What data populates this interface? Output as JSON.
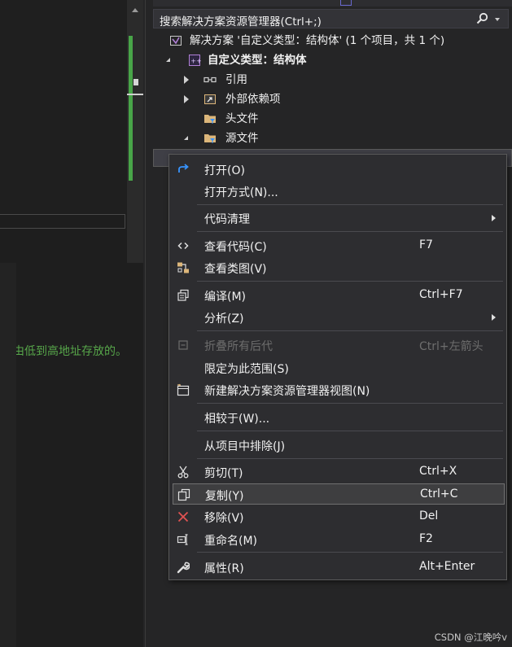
{
  "editor": {
    "comment_text": "由低到高地址存放的。"
  },
  "explorer": {
    "search_placeholder": "搜索解决方案资源管理器(Ctrl+;)",
    "tree": {
      "solution": "解决方案 '自定义类型：结构体' (1 个项目，共 1 个)",
      "project": "自定义类型：结构体",
      "references": "引用",
      "external_deps": "外部依赖项",
      "header_files": "头文件",
      "source_files": "源文件"
    }
  },
  "context_menu": {
    "items": [
      {
        "label": "打开(O)",
        "shortcut": "",
        "icon": "open-redo-icon",
        "enabled": true
      },
      {
        "label": "打开方式(N)...",
        "shortcut": "",
        "icon": "",
        "enabled": true
      },
      {
        "label": "代码清理",
        "shortcut": "",
        "icon": "",
        "enabled": true,
        "submenu": true
      },
      {
        "label": "查看代码(C)",
        "shortcut": "F7",
        "icon": "view-code-icon",
        "enabled": true
      },
      {
        "label": "查看类图(V)",
        "shortcut": "",
        "icon": "class-diagram-icon",
        "enabled": true
      },
      {
        "label": "编译(M)",
        "shortcut": "Ctrl+F7",
        "icon": "compile-icon",
        "enabled": true
      },
      {
        "label": "分析(Z)",
        "shortcut": "",
        "icon": "",
        "enabled": true,
        "submenu": true
      },
      {
        "label": "折叠所有后代",
        "shortcut": "Ctrl+左箭头",
        "icon": "collapse-all-icon",
        "enabled": false
      },
      {
        "label": "限定为此范围(S)",
        "shortcut": "",
        "icon": "",
        "enabled": true
      },
      {
        "label": "新建解决方案资源管理器视图(N)",
        "shortcut": "",
        "icon": "new-view-icon",
        "enabled": true
      },
      {
        "label": "相较于(W)...",
        "shortcut": "",
        "icon": "",
        "enabled": true
      },
      {
        "label": "从项目中排除(J)",
        "shortcut": "",
        "icon": "",
        "enabled": true
      },
      {
        "label": "剪切(T)",
        "shortcut": "Ctrl+X",
        "icon": "cut-scissors-icon",
        "enabled": true
      },
      {
        "label": "复制(Y)",
        "shortcut": "Ctrl+C",
        "icon": "copy-icon",
        "enabled": true,
        "highlighted": true
      },
      {
        "label": "移除(V)",
        "shortcut": "Del",
        "icon": "remove-x-icon",
        "enabled": true
      },
      {
        "label": "重命名(M)",
        "shortcut": "F2",
        "icon": "rename-icon",
        "enabled": true
      },
      {
        "label": "属性(R)",
        "shortcut": "Alt+Enter",
        "icon": "wrench-properties-icon",
        "enabled": true
      }
    ]
  },
  "colors": {
    "background": "#1e1e1e",
    "panel": "#252526",
    "menu_bg": "#2d2d30",
    "comment_green": "#57a64a",
    "accent_purple": "#b180d7",
    "folder_yellow": "#dcb67a",
    "remove_red": "#e05252",
    "open_blue": "#3794ff"
  },
  "watermark": "CSDN @江晚吟v"
}
